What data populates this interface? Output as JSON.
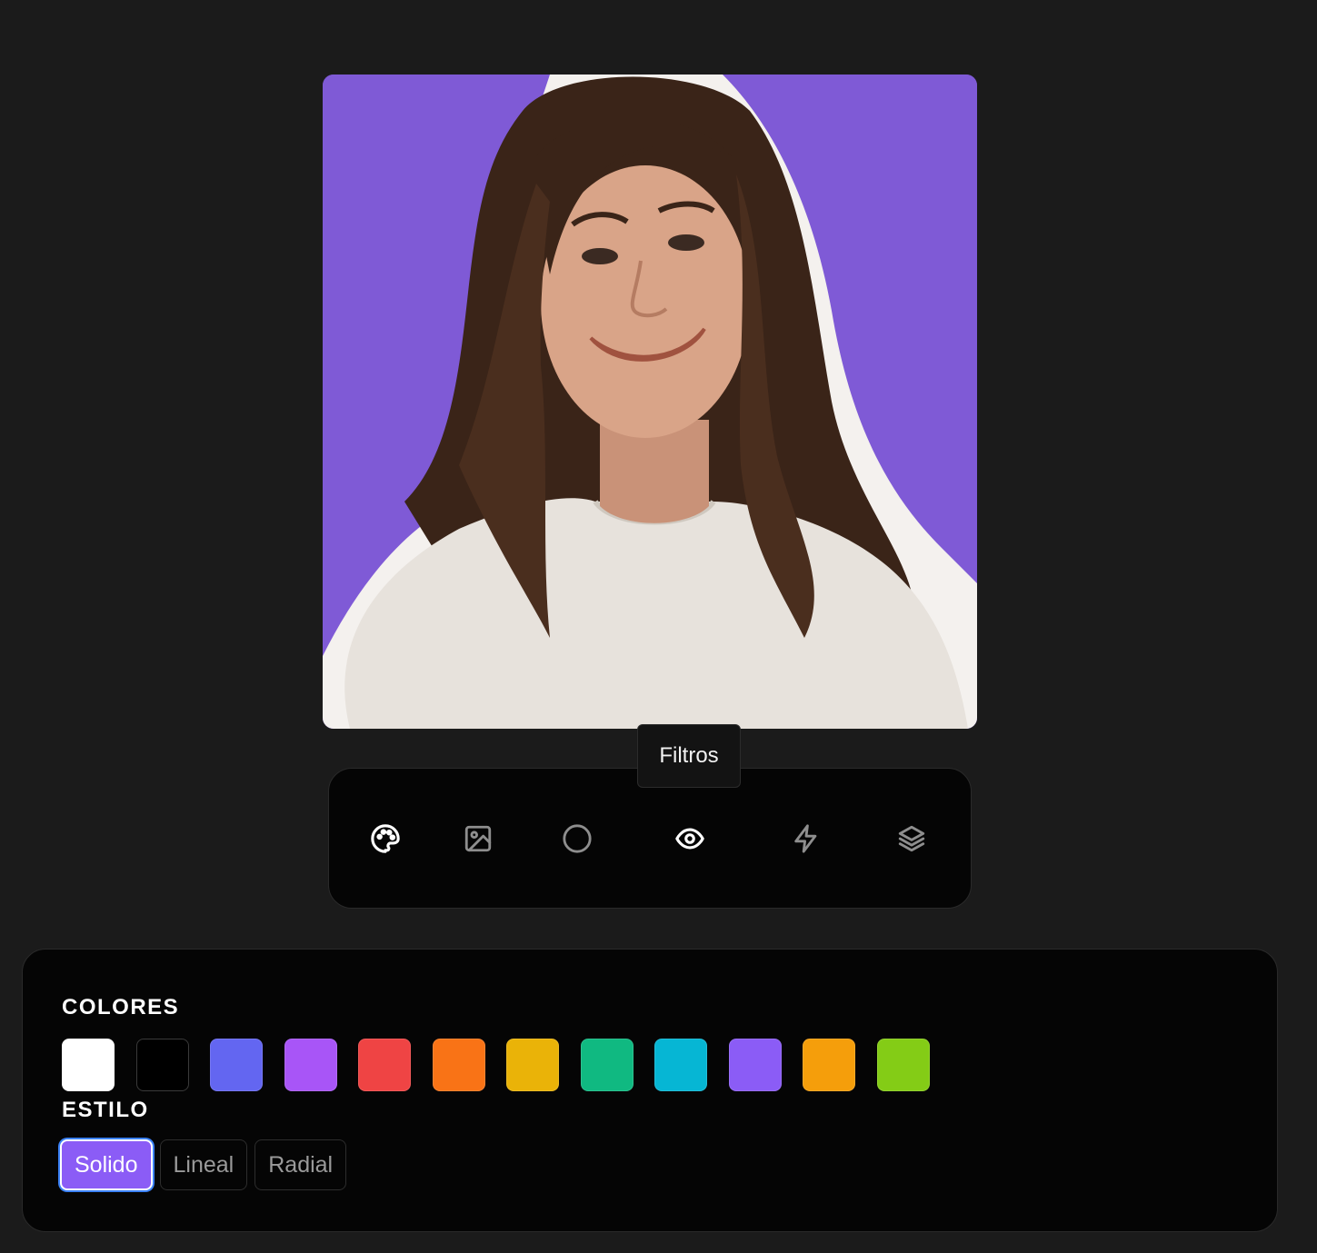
{
  "tooltip": {
    "text": "Filtros"
  },
  "toolbar": {
    "tools": [
      {
        "icon": "palette-icon",
        "active": true
      },
      {
        "icon": "image-icon",
        "active": false
      },
      {
        "icon": "circle-icon",
        "active": false
      },
      {
        "icon": "eye-icon",
        "active": true
      },
      {
        "icon": "bolt-icon",
        "active": false
      },
      {
        "icon": "layers-icon",
        "active": false
      }
    ]
  },
  "panel": {
    "colors_label": "COLORES",
    "style_label": "ESTILO",
    "colors": [
      "#ffffff",
      "#000000",
      "#6366f1",
      "#a855f7",
      "#ef4444",
      "#f97316",
      "#eab308",
      "#10b981",
      "#06b6d4",
      "#8b5cf6",
      "#f59e0b",
      "#84cc16"
    ],
    "styles": [
      {
        "label": "Solido",
        "selected": true
      },
      {
        "label": "Lineal",
        "selected": false
      },
      {
        "label": "Radial",
        "selected": false
      }
    ]
  },
  "photo": {
    "background_color": "#7f5ad6"
  }
}
